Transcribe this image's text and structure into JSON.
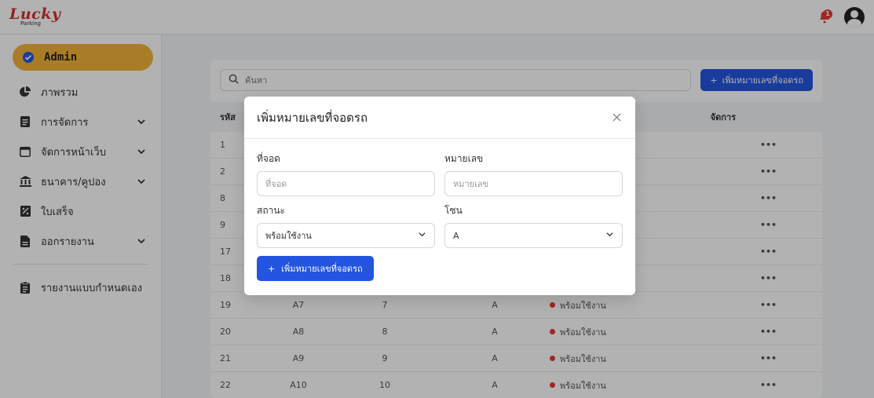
{
  "header": {
    "logo_text": "Lucky",
    "logo_sub": "Parking",
    "notification_count": "1"
  },
  "sidebar": {
    "items": [
      {
        "label": "Admin"
      },
      {
        "label": "ภาพรวม"
      },
      {
        "label": "การจัดการ"
      },
      {
        "label": "จัดการหน้าเว็บ"
      },
      {
        "label": "ธนาคาร/คูปอง"
      },
      {
        "label": "ใบเสร็จ"
      },
      {
        "label": "ออกรายงาน"
      },
      {
        "label": "รายงานแบบกำหนดเอง"
      }
    ]
  },
  "main": {
    "search_placeholder": "ค้นหา",
    "add_button_label": "เพิ่มหมายเลขที่จอดรถ",
    "table": {
      "headers": {
        "id": "รหัส",
        "manage": "จัดการ"
      },
      "rows": [
        {
          "id": "1",
          "name": "",
          "number": "",
          "zone": "",
          "status": "",
          "manage": "•••"
        },
        {
          "id": "2",
          "name": "",
          "number": "",
          "zone": "",
          "status": "",
          "manage": "•••"
        },
        {
          "id": "8",
          "name": "",
          "number": "",
          "zone": "",
          "status": "",
          "manage": "•••"
        },
        {
          "id": "9",
          "name": "",
          "number": "",
          "zone": "",
          "status": "",
          "manage": "•••"
        },
        {
          "id": "17",
          "name": "",
          "number": "",
          "zone": "",
          "status": "",
          "manage": "•••"
        },
        {
          "id": "18",
          "name": "",
          "number": "",
          "zone": "",
          "status": "",
          "manage": "•••"
        },
        {
          "id": "19",
          "name": "A7",
          "number": "7",
          "zone": "A",
          "status": "พร้อมใช้งาน",
          "manage": "•••"
        },
        {
          "id": "20",
          "name": "A8",
          "number": "8",
          "zone": "A",
          "status": "พร้อมใช้งาน",
          "manage": "•••"
        },
        {
          "id": "21",
          "name": "A9",
          "number": "9",
          "zone": "A",
          "status": "พร้อมใช้งาน",
          "manage": "•••"
        },
        {
          "id": "22",
          "name": "A10",
          "number": "10",
          "zone": "A",
          "status": "พร้อมใช้งาน",
          "manage": "•••"
        }
      ]
    }
  },
  "modal": {
    "title": "เพิ่มหมายเลขที่จอดรถ",
    "fields": {
      "location_label": "ที่จอด",
      "location_placeholder": "ที่จอด",
      "number_label": "หมายเลข",
      "number_placeholder": "หมายเลข",
      "status_label": "สถานะ",
      "status_value": "พร้อมใช้งาน",
      "zone_label": "โซน",
      "zone_value": "A"
    },
    "submit_label": "เพิ่มหมายเลขที่จอดรถ"
  },
  "colors": {
    "accent": "#2355e0",
    "sidebar_active": "#f2b43a",
    "status_dot": "#e53935",
    "brand": "#d32f2f"
  }
}
